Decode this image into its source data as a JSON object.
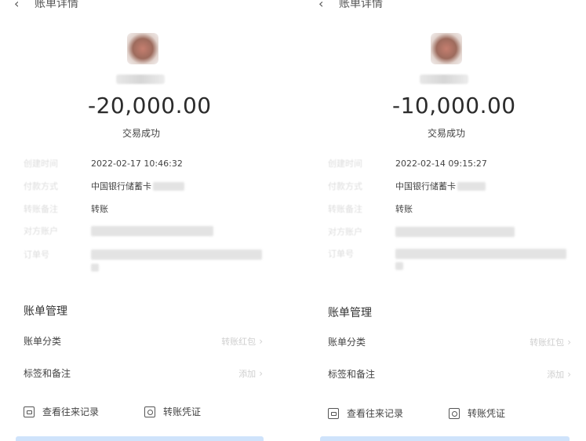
{
  "panels": [
    {
      "header_title": "账单详情",
      "back_icon": "‹",
      "amount": "-20,000.00",
      "status": "交易成功",
      "details": [
        {
          "label": "创建时间",
          "value": "2022-02-17 10:46:32"
        },
        {
          "label": "付款方式",
          "value": "中国银行储蓄卡"
        },
        {
          "label": "转账备注",
          "value": "转账"
        },
        {
          "label": "对方账户",
          "value": ""
        },
        {
          "label": "订单号",
          "value": ""
        }
      ],
      "management_title": "账单管理",
      "management_rows": [
        {
          "label": "账单分类",
          "value": "转账红包"
        },
        {
          "label": "标签和备注",
          "value": "添加"
        }
      ],
      "links": [
        {
          "label": "查看往来记录",
          "icon": "records-icon"
        },
        {
          "label": "转账凭证",
          "icon": "voucher-icon"
        }
      ]
    },
    {
      "header_title": "账单详情",
      "back_icon": "‹",
      "amount": "-10,000.00",
      "status": "交易成功",
      "details": [
        {
          "label": "创建时间",
          "value": "2022-02-14 09:15:27"
        },
        {
          "label": "付款方式",
          "value": "中国银行储蓄卡"
        },
        {
          "label": "转账备注",
          "value": "转账"
        },
        {
          "label": "对方账户",
          "value": ""
        },
        {
          "label": "订单号",
          "value": ""
        }
      ],
      "management_title": "账单管理",
      "management_rows": [
        {
          "label": "账单分类",
          "value": "转账红包"
        },
        {
          "label": "标签和备注",
          "value": "添加"
        }
      ],
      "links": [
        {
          "label": "查看往来记录",
          "icon": "records-icon"
        },
        {
          "label": "转账凭证",
          "icon": "voucher-icon"
        }
      ]
    }
  ]
}
